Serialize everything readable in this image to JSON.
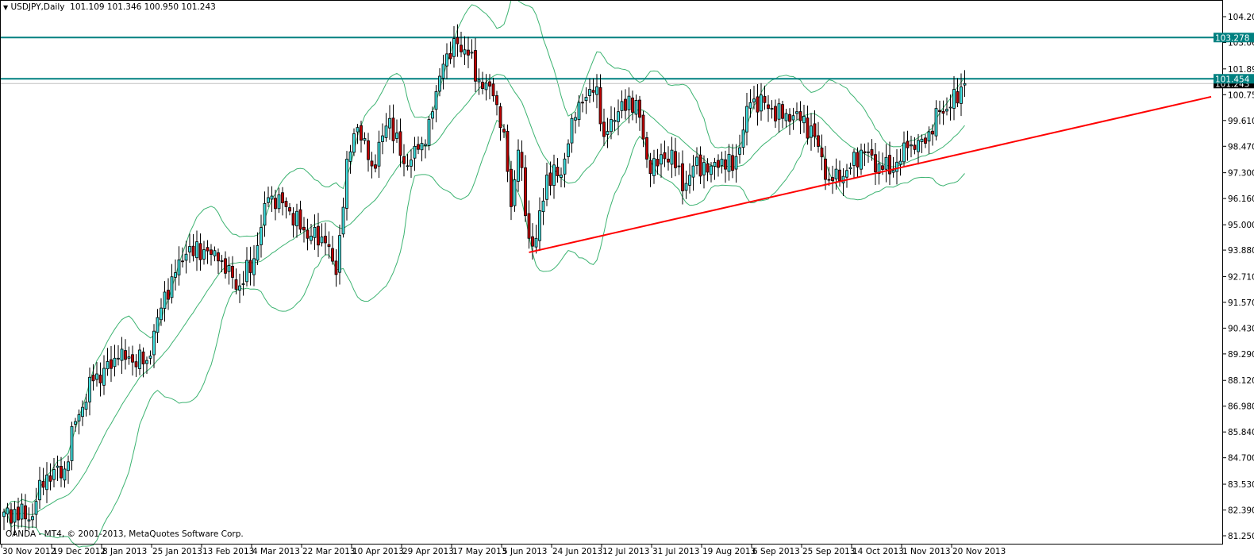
{
  "header": {
    "arrow": "▼",
    "symbol": "USDJPY,Daily",
    "ohlc": "101.109 101.346 100.950 101.243"
  },
  "footer": {
    "copyright": "OANDA - MT4, © 2001-2013, MetaQuotes Software Corp."
  },
  "colors": {
    "bull": "#40e0e0",
    "bear": "#c00000",
    "bands": "#3cb371",
    "level": "#008080",
    "trend": "#ff0000",
    "bid": "#c0c0c0"
  },
  "chart_data": {
    "type": "candlestick",
    "title": "USDJPY,Daily",
    "ylim": [
      81.25,
      104.2
    ],
    "y_ticks": [
      "104.200",
      "103.060",
      "101.890",
      "100.750",
      "99.610",
      "98.470",
      "97.300",
      "96.160",
      "95.000",
      "93.880",
      "92.710",
      "91.570",
      "90.430",
      "89.290",
      "88.120",
      "86.980",
      "85.840",
      "84.700",
      "83.530",
      "82.390",
      "81.250"
    ],
    "x_ticks": [
      "30 Nov 2012",
      "19 Dec 2012",
      "8 Jan 2013",
      "25 Jan 2013",
      "13 Feb 2013",
      "4 Mar 2013",
      "22 Mar 2013",
      "10 Apr 2013",
      "29 Apr 2013",
      "17 May 2013",
      "5 Jun 2013",
      "24 Jun 2013",
      "12 Jul 2013",
      "31 Jul 2013",
      "19 Aug 2013",
      "6 Sep 2013",
      "25 Sep 2013",
      "14 Oct 2013",
      "1 Nov 2013",
      "20 Nov 2013"
    ],
    "bars_per_x_tick": 14,
    "close_anchors": [
      [
        0,
        82.3
      ],
      [
        8,
        82.1
      ],
      [
        10,
        83.7
      ],
      [
        17,
        84.2
      ],
      [
        20,
        86.3
      ],
      [
        25,
        88.1
      ],
      [
        32,
        89.1
      ],
      [
        40,
        89.0
      ],
      [
        43,
        90.9
      ],
      [
        47,
        92.7
      ],
      [
        51,
        93.7
      ],
      [
        56,
        93.9
      ],
      [
        60,
        93.4
      ],
      [
        66,
        92.3
      ],
      [
        70,
        93.5
      ],
      [
        74,
        96.2
      ],
      [
        79,
        95.8
      ],
      [
        83,
        94.8
      ],
      [
        90,
        94.2
      ],
      [
        93,
        92.8
      ],
      [
        96,
        97.9
      ],
      [
        99,
        99.3
      ],
      [
        103,
        97.6
      ],
      [
        108,
        99.7
      ],
      [
        112,
        97.7
      ],
      [
        117,
        98.6
      ],
      [
        120,
        100.0
      ],
      [
        123,
        102.1
      ],
      [
        127,
        103.0
      ],
      [
        130,
        102.5
      ],
      [
        133,
        101.4
      ],
      [
        137,
        100.7
      ],
      [
        140,
        99.1
      ],
      [
        142,
        95.8
      ],
      [
        144,
        98.3
      ],
      [
        147,
        94.4
      ],
      [
        149,
        94.4
      ],
      [
        152,
        97.2
      ],
      [
        156,
        97.2
      ],
      [
        159,
        99.7
      ],
      [
        162,
        100.4
      ],
      [
        166,
        101.1
      ],
      [
        168,
        98.9
      ],
      [
        172,
        100.0
      ],
      [
        177,
        100.5
      ],
      [
        180,
        97.9
      ],
      [
        183,
        97.6
      ],
      [
        187,
        98.3
      ],
      [
        190,
        96.5
      ],
      [
        193,
        97.6
      ],
      [
        198,
        97.6
      ],
      [
        201,
        97.9
      ],
      [
        204,
        97.4
      ],
      [
        209,
        100.4
      ],
      [
        213,
        100.4
      ],
      [
        218,
        99.7
      ],
      [
        222,
        100.0
      ],
      [
        227,
        98.9
      ],
      [
        231,
        97.0
      ],
      [
        236,
        97.4
      ],
      [
        240,
        98.3
      ],
      [
        245,
        97.7
      ],
      [
        249,
        97.4
      ],
      [
        253,
        98.4
      ],
      [
        258,
        98.6
      ],
      [
        262,
        100.0
      ],
      [
        265,
        100.2
      ],
      [
        269,
        101.243
      ]
    ],
    "bollinger": {
      "period": 20,
      "deviation": 2
    },
    "levels": [
      {
        "price": 103.278,
        "label": "103.278"
      },
      {
        "price": 101.454,
        "label": "101.454"
      }
    ],
    "bid": {
      "price": 101.243,
      "label": "101.243"
    },
    "trendline": {
      "start": [
        147,
        93.78
      ],
      "end": [
        338,
        100.66
      ]
    }
  }
}
